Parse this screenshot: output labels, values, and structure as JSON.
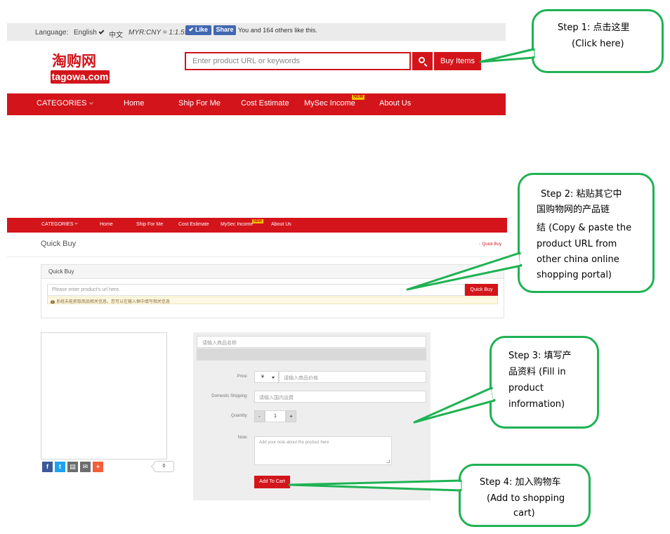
{
  "top": {
    "language_label": "Language:",
    "english": "English",
    "chinese": "中文",
    "rate": "MYR:CNY = 1:1.55",
    "fb_like": "Like",
    "fb_share": "Share",
    "fb_count": "You and 164 others like this.",
    "logo_cn": "淘购网",
    "logo_en": "tagowa.com",
    "search_placeholder": "Enter product URL or keywords",
    "buy_items": "Buy Items",
    "nav": [
      "CATEGORIES",
      "Home",
      "Ship For Me",
      "Cost Estimate",
      "MySec Income",
      "About Us"
    ],
    "new_badge": "NEW"
  },
  "quickbuy": {
    "nav": [
      "CATEGORIES",
      "Home",
      "Ship For Me",
      "Cost Estimate",
      "MySec Income",
      "About Us"
    ],
    "new_badge": "NEW",
    "title": "Quick Buy",
    "breadcrumb": "Quick Buy",
    "panel_title": "Quick Buy",
    "url_placeholder": "Please enter product's url here.",
    "quick_buy_button": "Quick Buy",
    "notice": "系统未能抓取商品相关信息，您可以在输入框中填写相关信息",
    "share_count": "0",
    "name_placeholder": "请输入商品名称",
    "price_label": "Price:",
    "currency": "¥",
    "price_placeholder": "请输入商品价格",
    "shipping_label": "Domestic Shipping:",
    "shipping_placeholder": "请输入国内运费",
    "quantity_label": "Quantity:",
    "qty_minus": "-",
    "qty_value": "1",
    "qty_plus": "+",
    "note_label": "Note:",
    "note_placeholder": "Add your note about the product here",
    "add_to_cart": "Add To Cart"
  },
  "callouts": {
    "step1": [
      "Step 1: 点击这里",
      "(Click here)"
    ],
    "step2": [
      "Step 2: 粘贴其它中",
      "国购物网的产品链",
      "结 (Copy & paste the",
      "product URL from",
      "other china online",
      "shopping portal)"
    ],
    "step3": [
      "Step 3: 填写产",
      "品资料 (Fill in",
      "product",
      "information)"
    ],
    "step4": [
      "Step 4: 加入购物车",
      "(Add to shopping",
      "cart)"
    ]
  },
  "colors": {
    "brand_red": "#d3141b",
    "callout_green": "#1fb254",
    "fb_blue": "#4267b2"
  }
}
